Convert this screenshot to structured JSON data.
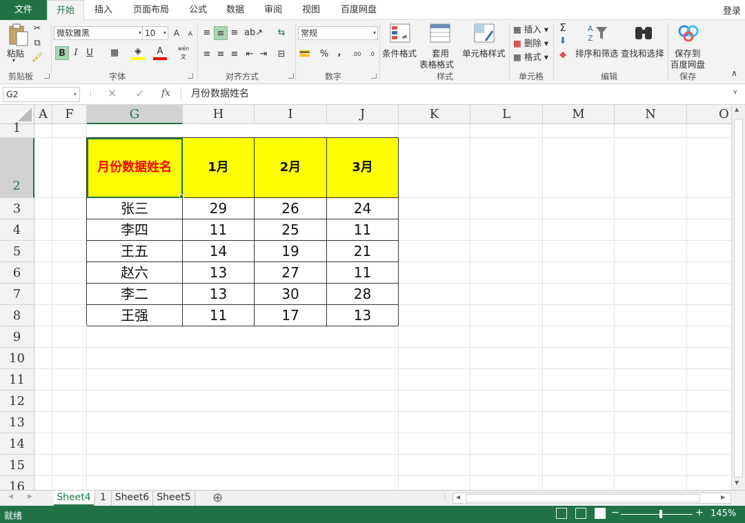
{
  "tabs": {
    "file": "文件",
    "items": [
      "开始",
      "插入",
      "页面布局",
      "公式",
      "数据",
      "审阅",
      "视图",
      "百度网盘"
    ],
    "active": "开始",
    "login": "登录"
  },
  "ribbon": {
    "clipboard": {
      "paste": "粘贴",
      "label": "剪贴板"
    },
    "font": {
      "name": "微软雅黑",
      "size": "10",
      "bold": "B",
      "italic": "I",
      "underline": "U",
      "grow": "A",
      "shrink": "A",
      "label": "字体",
      "phonetic": "wén"
    },
    "alignment": {
      "label": "对齐方式"
    },
    "number": {
      "format": "常规",
      "percent": "%",
      "comma": ",",
      "inc_decimal": ".00",
      "dec_decimal": ".0",
      "label": "数字"
    },
    "styles": {
      "conditional": "条件格式",
      "table_1": "套用",
      "table_2": "表格格式",
      "cell_styles": "单元格样式",
      "label": "样式"
    },
    "cells": {
      "insert": "插入",
      "delete": "删除",
      "format": "格式",
      "label": "单元格"
    },
    "editing": {
      "sort": "排序和筛选",
      "find": "查找和选择",
      "label": "编辑"
    },
    "save": {
      "line1": "保存到",
      "line2": "百度网盘",
      "label": "保存"
    }
  },
  "formula_bar": {
    "name_box": "G2",
    "fx": "fx",
    "content": "月份数据姓名"
  },
  "columns": [
    "A",
    "F",
    "G",
    "H",
    "I",
    "J",
    "K",
    "L",
    "M",
    "N",
    "O"
  ],
  "rows": [
    "1",
    "2",
    "3",
    "4",
    "5",
    "6",
    "7",
    "8",
    "9",
    "10",
    "11",
    "12",
    "13",
    "14",
    "15",
    "16"
  ],
  "table": {
    "headers": [
      "月份数据姓名",
      "1月",
      "2月",
      "3月"
    ],
    "rows": [
      [
        "张三",
        "29",
        "26",
        "24"
      ],
      [
        "李四",
        "11",
        "25",
        "11"
      ],
      [
        "王五",
        "14",
        "19",
        "21"
      ],
      [
        "赵六",
        "13",
        "27",
        "11"
      ],
      [
        "李二",
        "13",
        "30",
        "28"
      ],
      [
        "王强",
        "11",
        "17",
        "13"
      ]
    ]
  },
  "sheets": {
    "items": [
      "Sheet4",
      "1",
      "Sheet6",
      "Sheet5"
    ],
    "active": "Sheet4",
    "add": "⊕"
  },
  "status": {
    "ready": "就绪",
    "zoom": "145%"
  },
  "colors": {
    "accent": "#217346",
    "header_fill": "#ffff00",
    "header_text": "#ff0000"
  }
}
